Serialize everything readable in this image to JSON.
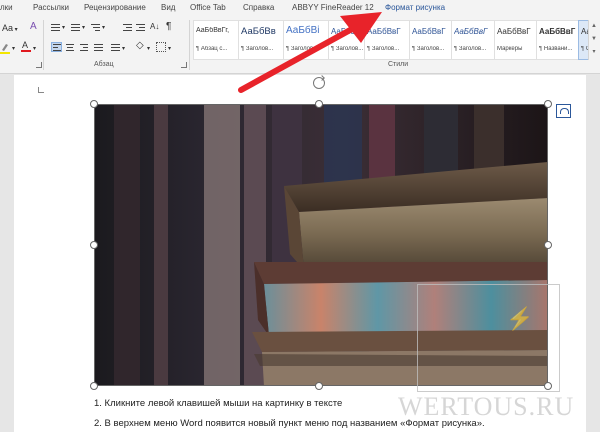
{
  "tabs": [
    {
      "label": "лки"
    },
    {
      "label": "Рассылки"
    },
    {
      "label": "Рецензирование"
    },
    {
      "label": "Вид"
    },
    {
      "label": "Office Tab"
    },
    {
      "label": "Справка"
    },
    {
      "label": "ABBYY FineReader 12"
    },
    {
      "label": "Формат рисунка"
    }
  ],
  "ribbon": {
    "font_size_label": "Aa",
    "paragraph_mark": "¶",
    "paragraph_group_label": "Абзац",
    "styles_group_label": "Стили",
    "styles": [
      {
        "sample": "АаБбВвГг,",
        "name": "¶ Абзац с..."
      },
      {
        "sample": "АаБбВв",
        "name": "¶ Заголов..."
      },
      {
        "sample": "АаБбВі",
        "name": "¶ Заголов..."
      },
      {
        "sample": "АаБбВвГ",
        "name": "¶ Заголов..."
      },
      {
        "sample": "АаБбВвГ",
        "name": "¶ Заголов..."
      },
      {
        "sample": "АаБбВвГ",
        "name": "¶ Заголов..."
      },
      {
        "sample": "АаБбВвГ",
        "name": "¶ Заголов..."
      },
      {
        "sample": "АаБбВвГ",
        "name": "Маркеры"
      },
      {
        "sample": "АаБбВвГ",
        "name": "¶ Названи..."
      },
      {
        "sample": "АаБб",
        "name": "¶ Обы"
      }
    ]
  },
  "document": {
    "lines": [
      "1. Кликните левой клавишей мыши на картинку в тексте",
      "2. В верхнем меню Word появится новый пункт меню под названием «Формат рисунка»."
    ]
  },
  "watermark": "WERTOUS.RU",
  "colors": {
    "accent": "#2b579a",
    "arrow": "#e8232a"
  }
}
